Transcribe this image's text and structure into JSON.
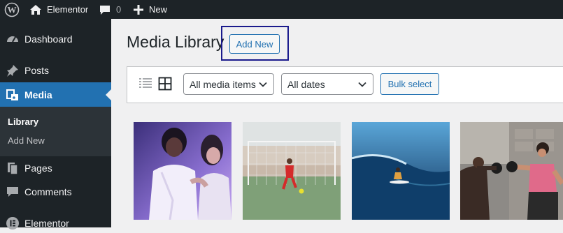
{
  "adminbar": {
    "site_name": "Elementor",
    "comments_count": "0",
    "new_label": "New"
  },
  "sidebar": {
    "items": [
      {
        "label": "Dashboard",
        "icon": "dashboard-icon"
      },
      {
        "label": "Posts",
        "icon": "pin-icon"
      },
      {
        "label": "Media",
        "icon": "media-icon"
      },
      {
        "label": "Pages",
        "icon": "pages-icon"
      },
      {
        "label": "Comments",
        "icon": "comments-icon"
      },
      {
        "label": "Elementor",
        "icon": "elementor-icon"
      }
    ],
    "submenu": [
      {
        "label": "Library"
      },
      {
        "label": "Add New"
      }
    ]
  },
  "main": {
    "title": "Media Library",
    "add_new_label": "Add New",
    "filters": {
      "media_type": "All media items",
      "dates": "All dates"
    },
    "bulk_select_label": "Bulk select"
  },
  "colors": {
    "adminbar_bg": "#1d2327",
    "accent": "#2271b1",
    "focus_outline": "#1a1a8c"
  }
}
